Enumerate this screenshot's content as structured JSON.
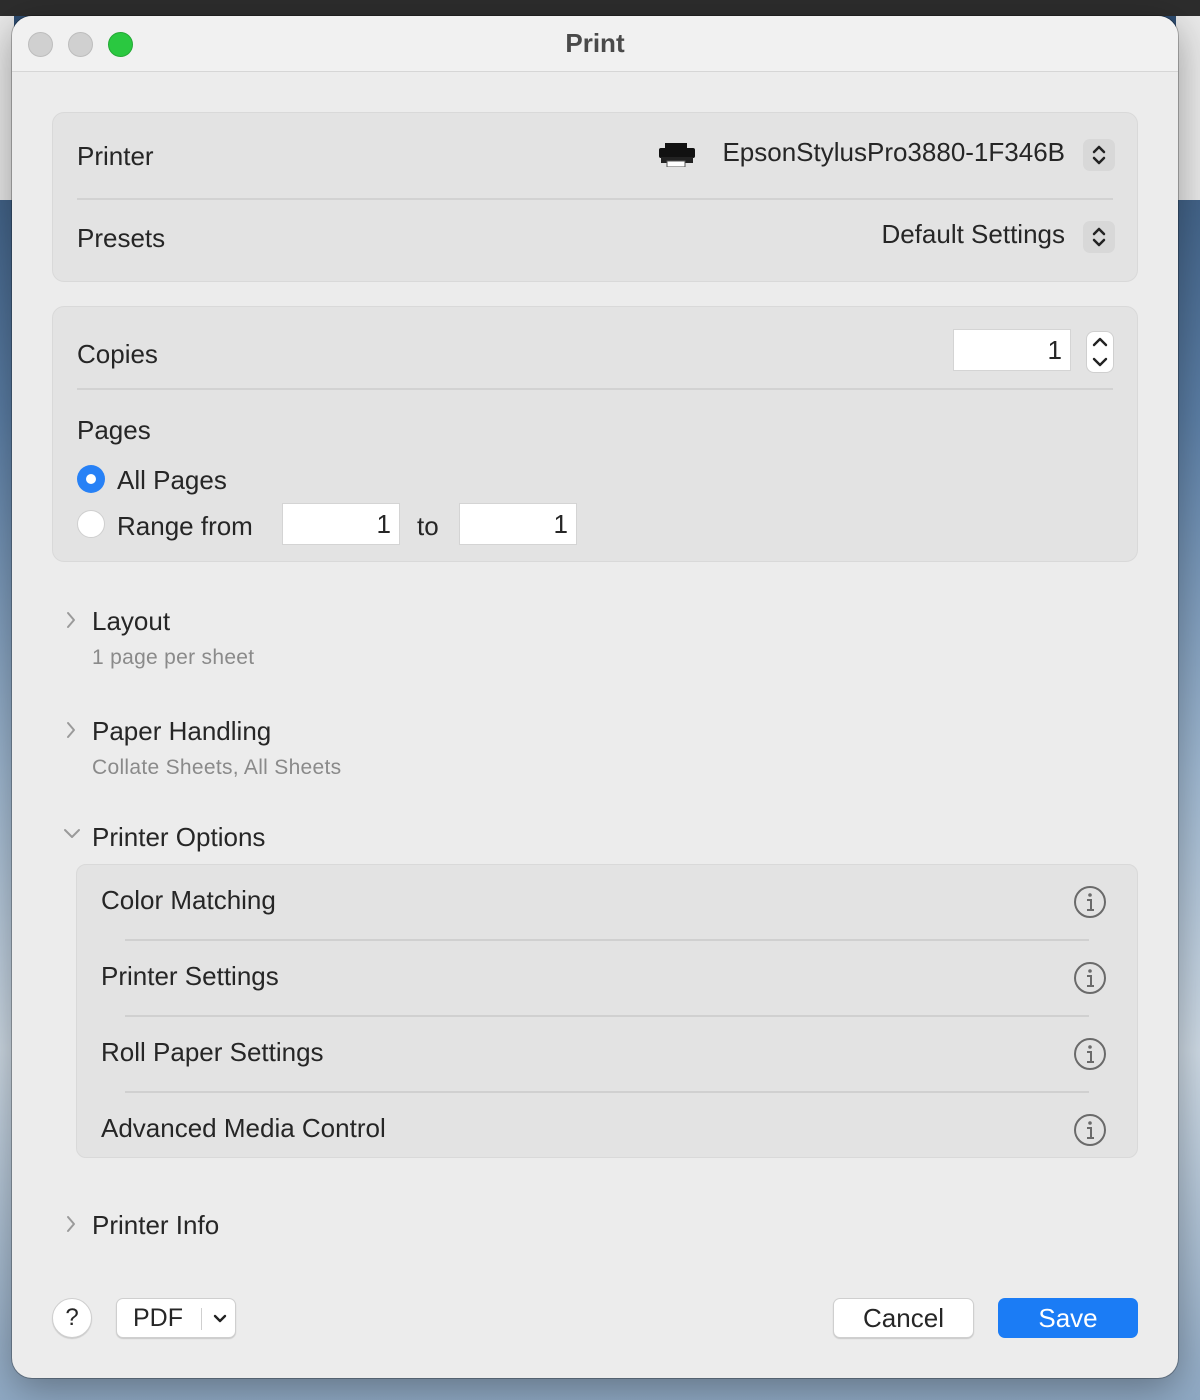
{
  "window": {
    "title": "Print"
  },
  "printer": {
    "label": "Printer",
    "value": "EpsonStylusPro3880-1F346B",
    "icon": "printer-icon"
  },
  "presets": {
    "label": "Presets",
    "value": "Default Settings"
  },
  "copies": {
    "label": "Copies",
    "value": "1"
  },
  "pages": {
    "label": "Pages",
    "all_label": "All Pages",
    "range_label": "Range from",
    "to_label": "to",
    "range_from": "1",
    "range_to": "1",
    "selected": "all"
  },
  "sections": {
    "layout": {
      "title": "Layout",
      "summary": "1 page per sheet"
    },
    "paper_handling": {
      "title": "Paper Handling",
      "summary": "Collate Sheets, All Sheets"
    },
    "printer_options": {
      "title": "Printer Options",
      "items": [
        {
          "label": "Color Matching"
        },
        {
          "label": "Printer Settings"
        },
        {
          "label": "Roll Paper Settings"
        },
        {
          "label": "Advanced Media Control"
        }
      ]
    },
    "printer_info": {
      "title": "Printer Info"
    }
  },
  "footer": {
    "help_label": "?",
    "pdf_label": "PDF",
    "cancel_label": "Cancel",
    "save_label": "Save"
  },
  "colors": {
    "accent": "#1b7cf5",
    "radio_selected": "#2781f6",
    "zoom_button": "#2ac840"
  }
}
